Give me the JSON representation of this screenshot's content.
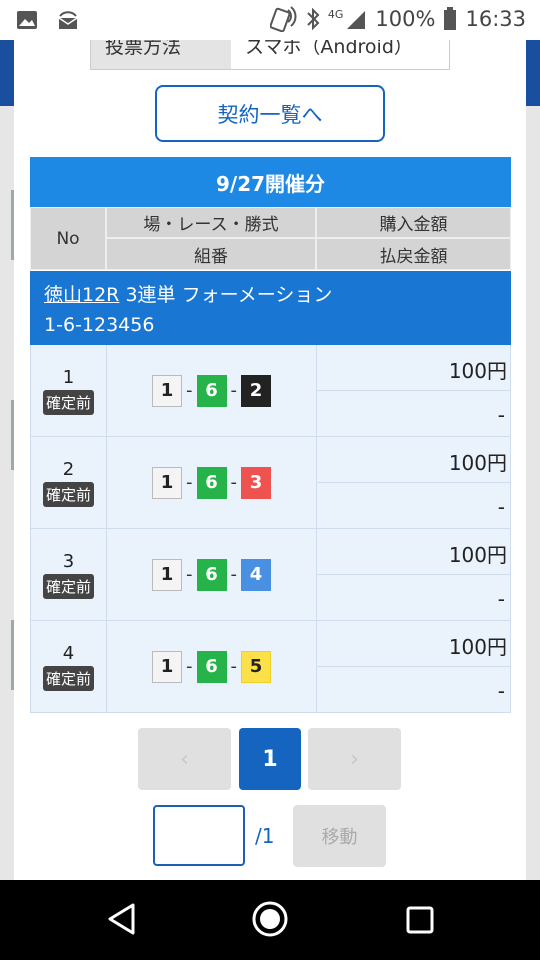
{
  "status_bar": {
    "network": "4G",
    "battery": "100%",
    "time": "16:33"
  },
  "method": {
    "label": "投票方法",
    "value": "スマホ（Android）"
  },
  "contract_button": "契約一覧へ",
  "date_header": "9/27開催分",
  "table_headers": {
    "no": "No",
    "race_info": "場・レース・勝式",
    "combination": "組番",
    "purchase_amount": "購入金額",
    "refund_amount": "払戻金額"
  },
  "bet": {
    "venue": "徳山12R",
    "type": "3連単 フォーメーション",
    "code": "1-6-123456"
  },
  "rows": [
    {
      "no": "1",
      "status": "確定前",
      "c1": "1",
      "c2": "6",
      "c3": "2",
      "amount": "100円",
      "payout": "-"
    },
    {
      "no": "2",
      "status": "確定前",
      "c1": "1",
      "c2": "6",
      "c3": "3",
      "amount": "100円",
      "payout": "-"
    },
    {
      "no": "3",
      "status": "確定前",
      "c1": "1",
      "c2": "6",
      "c3": "4",
      "amount": "100円",
      "payout": "-"
    },
    {
      "no": "4",
      "status": "確定前",
      "c1": "1",
      "c2": "6",
      "c3": "5",
      "amount": "100円",
      "payout": "-"
    }
  ],
  "pager": {
    "prev": "‹",
    "current": "1",
    "next": "›"
  },
  "jump": {
    "value": "",
    "total": "/1",
    "button": "移動"
  },
  "colors": {
    "accent": "#1565c0",
    "header_blue": "#1e88e5",
    "boat_1": "#f4f4f4",
    "boat_2": "#222222",
    "boat_3": "#ef5350",
    "boat_4": "#4a90e2",
    "boat_5": "#fbe04a",
    "boat_6": "#26b34a"
  }
}
